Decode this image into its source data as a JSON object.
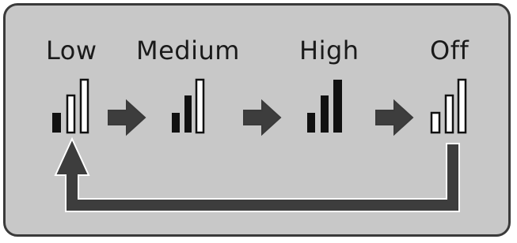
{
  "levels": [
    {
      "label": "Low",
      "bars_filled": 1
    },
    {
      "label": "Medium",
      "bars_filled": 2
    },
    {
      "label": "High",
      "bars_filled": 3
    },
    {
      "label": "Off",
      "bars_filled": 0
    }
  ],
  "colors": {
    "panel_background": "#c8c8c8",
    "border": "#3a3a3a",
    "bar_filled": "#111111",
    "bar_empty": "#ffffff",
    "arrow_fill": "#3d3d3d",
    "text": "#1a1a1a"
  }
}
